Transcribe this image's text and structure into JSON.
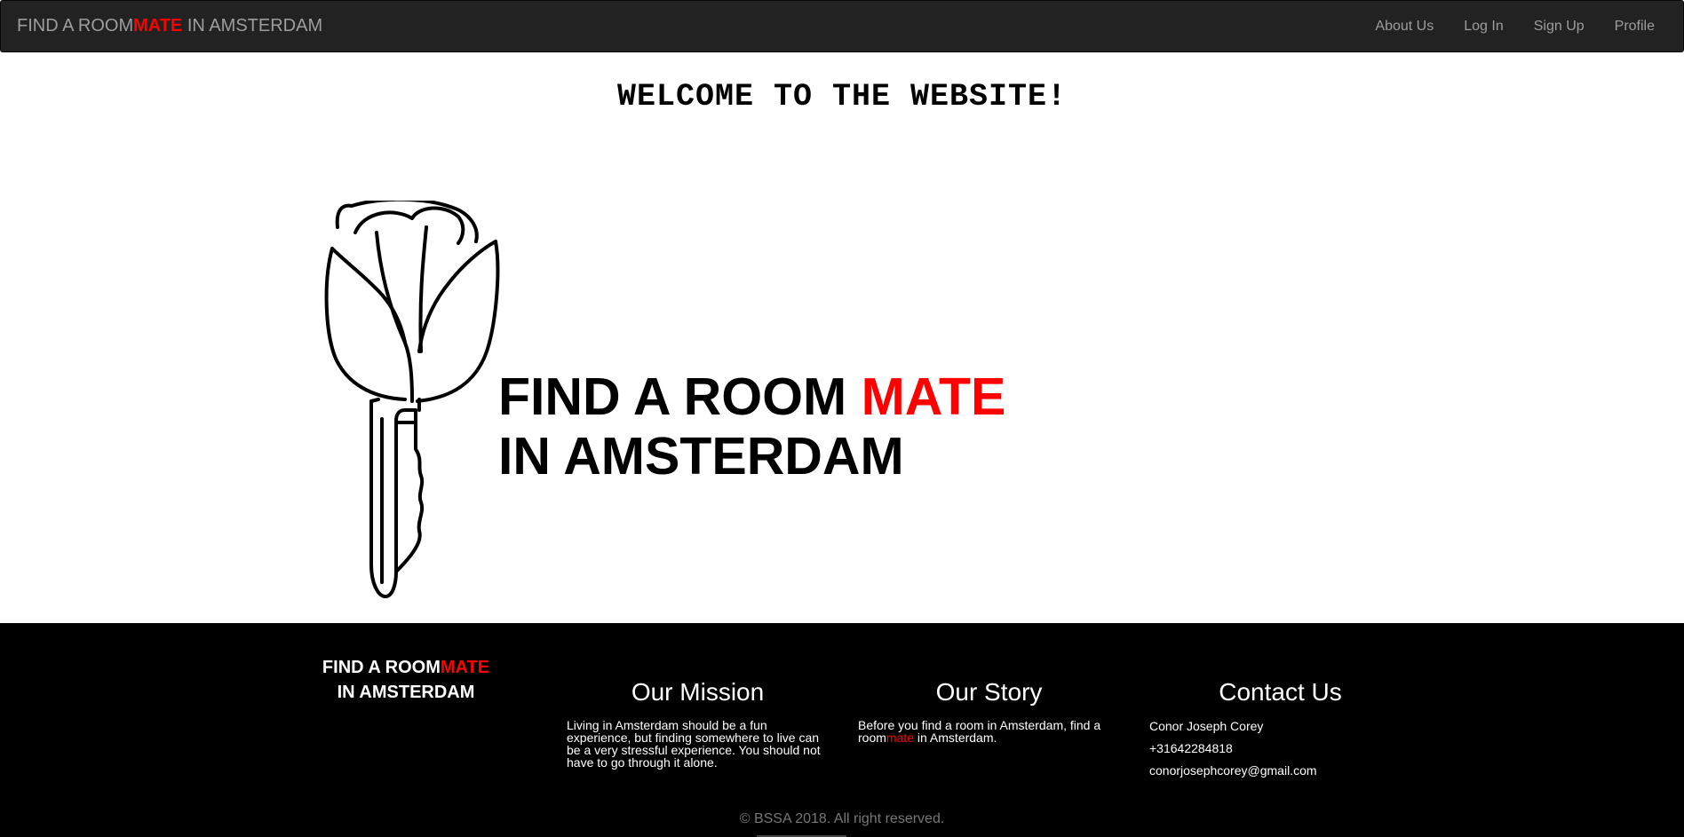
{
  "navbar": {
    "brand_prefix": "FIND A ROOM",
    "brand_highlight": "MATE",
    "brand_suffix": " IN AMSTERDAM",
    "links": [
      "About Us",
      "Log In",
      "Sign Up",
      "Profile"
    ]
  },
  "welcome": "WELCOME TO THE WEBSITE!",
  "logo": {
    "line1_prefix": "FIND A ROOM ",
    "line1_highlight": "MATE",
    "line2": "IN AMSTERDAM"
  },
  "footer": {
    "brand_prefix": "FIND A ROOM",
    "brand_highlight": "MATE",
    "brand_line2": "IN AMSTERDAM",
    "mission": {
      "title": "Our Mission",
      "text": "Living in Amsterdam should be a fun experience, but finding somewhere to live can be a very stressful experience. You should not have to go through it alone."
    },
    "story": {
      "title": "Our Story",
      "text_prefix": "Before you find a room in Amsterdam, find a room",
      "text_highlight": "mate",
      "text_suffix": " in Amsterdam."
    },
    "contact": {
      "title": "Contact Us",
      "name": "Conor Joseph Corey",
      "phone": "+31642284818",
      "email": "conorjosephcorey@gmail.com"
    },
    "copyright": "© BSSA 2018. All right reserved."
  },
  "colors": {
    "navbar_bg": "#222222",
    "nav_text": "#9d9d9d",
    "accent_red": "#ff0000",
    "footer_bg": "#000000",
    "copyright": "#777777"
  },
  "icons": [
    "tulip-key-logo"
  ]
}
